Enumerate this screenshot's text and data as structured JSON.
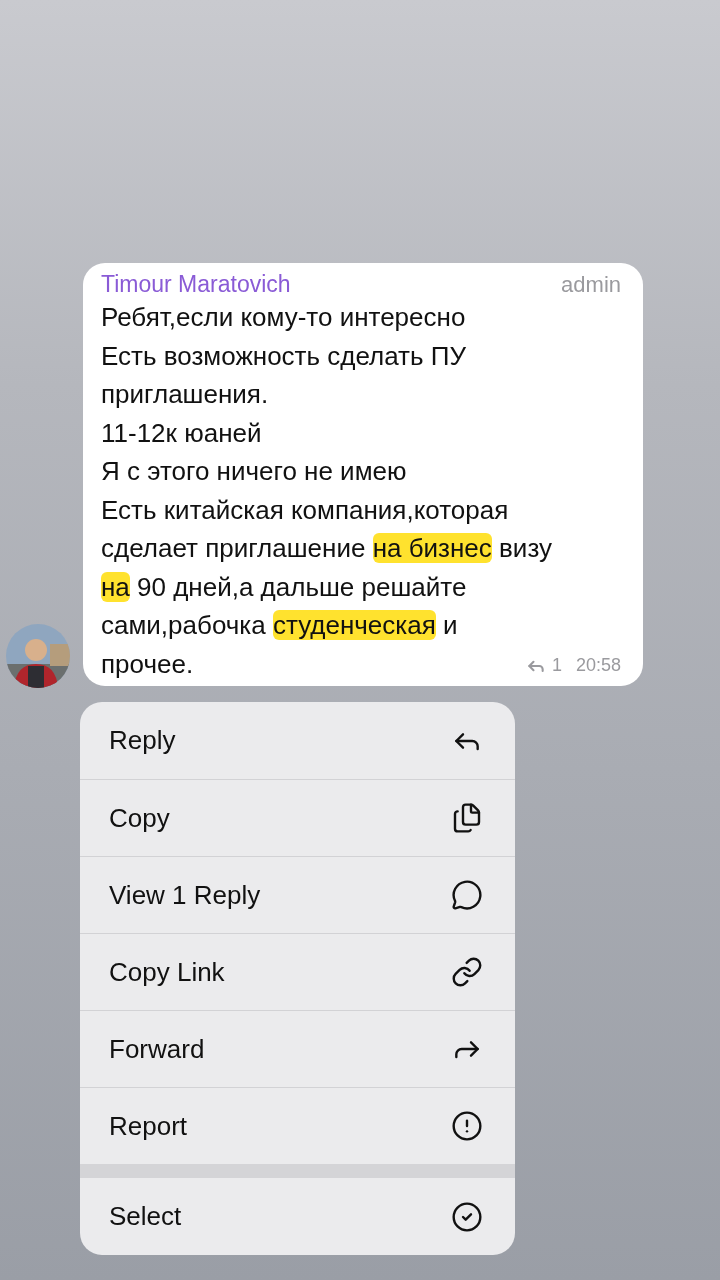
{
  "message": {
    "author": "Timour Maratovich",
    "role": "admin",
    "lines": [
      [
        {
          "text": "Ребят,если кому-то интересно",
          "highlighted": false
        }
      ],
      [
        {
          "text": "Есть возможность сделать ПУ",
          "highlighted": false
        }
      ],
      [
        {
          "text": "приглашения.",
          "highlighted": false
        }
      ],
      [
        {
          "text": "11-12к юаней",
          "highlighted": false
        }
      ],
      [
        {
          "text": "Я с этого ничего не имею",
          "highlighted": false
        }
      ],
      [
        {
          "text": "Есть китайская компания,которая",
          "highlighted": false
        }
      ],
      [
        {
          "text": "сделает приглашение ",
          "highlighted": false
        },
        {
          "text": "на бизнес",
          "highlighted": true
        },
        {
          "text": " визу",
          "highlighted": false
        }
      ],
      [
        {
          "text": "на",
          "highlighted": true
        },
        {
          "text": " 90 дней,а дальше решайте",
          "highlighted": false
        }
      ],
      [
        {
          "text": "сами,рабочка ",
          "highlighted": false
        },
        {
          "text": "студенческая",
          "highlighted": true
        },
        {
          "text": " и",
          "highlighted": false
        }
      ],
      [
        {
          "text": "прочее.",
          "highlighted": false
        }
      ]
    ],
    "reply_count": "1",
    "time": "20:58"
  },
  "menu": {
    "groups": [
      [
        {
          "label": "Reply",
          "kind": "reply"
        },
        {
          "label": "Copy",
          "kind": "copy"
        },
        {
          "label": "View 1 Reply",
          "kind": "replies"
        },
        {
          "label": "Copy Link",
          "kind": "link"
        },
        {
          "label": "Forward",
          "kind": "forward"
        },
        {
          "label": "Report",
          "kind": "report"
        }
      ],
      [
        {
          "label": "Select",
          "kind": "select"
        }
      ]
    ]
  }
}
